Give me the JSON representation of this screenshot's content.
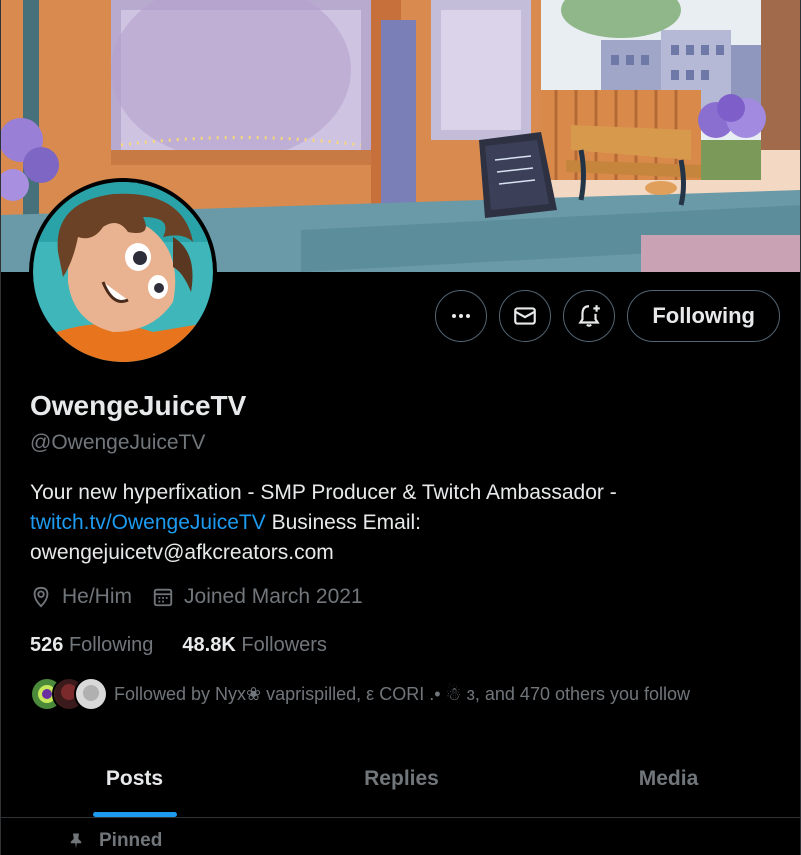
{
  "profile": {
    "display_name": "OwengeJuiceTV",
    "handle": "@OwengeJuiceTV",
    "bio_text": "Your new hyperfixation - SMP Producer & Twitch Ambassador -",
    "bio_link": "twitch.tv/OwengeJuiceTV",
    "bio_after_link": " Business Email:",
    "bio_email": "owengejuicetv@afkcreators.com",
    "pronouns": "He/Him",
    "joined": "Joined March 2021"
  },
  "actions": {
    "more_icon": "more-icon",
    "message_icon": "envelope-icon",
    "notify_icon": "bell-plus-icon",
    "follow_label": "Following"
  },
  "stats": {
    "following_count": "526",
    "following_label": "Following",
    "followers_count": "48.8K",
    "followers_label": "Followers"
  },
  "followed_by": {
    "text": "Followed by Nyx❀ vaprispilled, ε CORI .• ☃ ɜ, and 470 others you follow"
  },
  "tabs": [
    {
      "label": "Posts",
      "active": true
    },
    {
      "label": "Replies",
      "active": false
    },
    {
      "label": "Media",
      "active": false
    }
  ],
  "pinned": {
    "label": "Pinned",
    "icon": "pin-icon"
  },
  "colors": {
    "background": "#000000",
    "text_primary": "#e7e9ea",
    "text_secondary": "#71767b",
    "accent": "#1d9bf0",
    "border": "#536471"
  }
}
